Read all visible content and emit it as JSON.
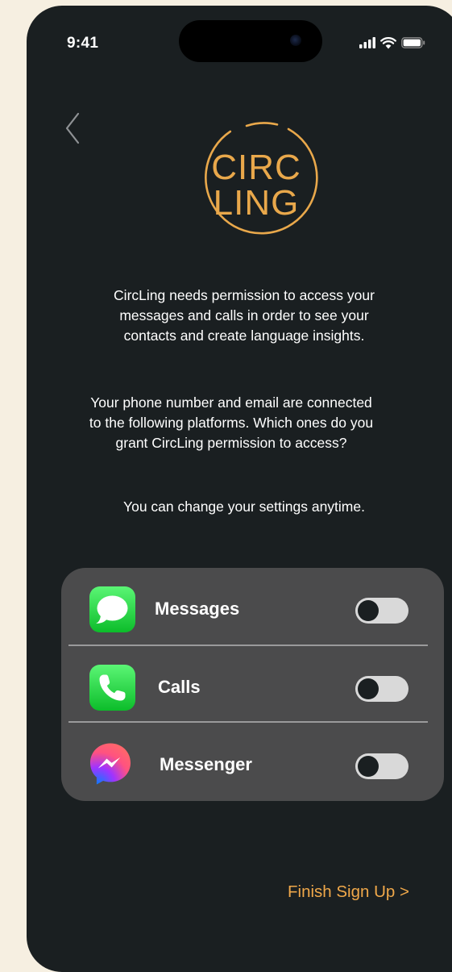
{
  "status_bar": {
    "time": "9:41"
  },
  "logo": {
    "line1": "CIRC",
    "line2": "LING"
  },
  "intro": {
    "permission_text": "CircLing needs permission to access your\nmessages and calls in order to see your\ncontacts and create language insights.",
    "platforms_text": "Your phone number and email are connected\nto the following platforms. Which ones do you\ngrant CircLing permission to access?",
    "settings_text": "You can change your settings anytime."
  },
  "permissions": [
    {
      "label": "Messages",
      "icon": "messages-icon",
      "enabled": false
    },
    {
      "label": "Calls",
      "icon": "phone-icon",
      "enabled": false
    },
    {
      "label": "Messenger",
      "icon": "messenger-icon",
      "enabled": false
    }
  ],
  "footer": {
    "finish_label": "Finish Sign Up >"
  },
  "colors": {
    "background": "#1a1f21",
    "accent": "#f0a84a",
    "card": "#4b4b4c",
    "page_backdrop": "#f6efe1"
  }
}
